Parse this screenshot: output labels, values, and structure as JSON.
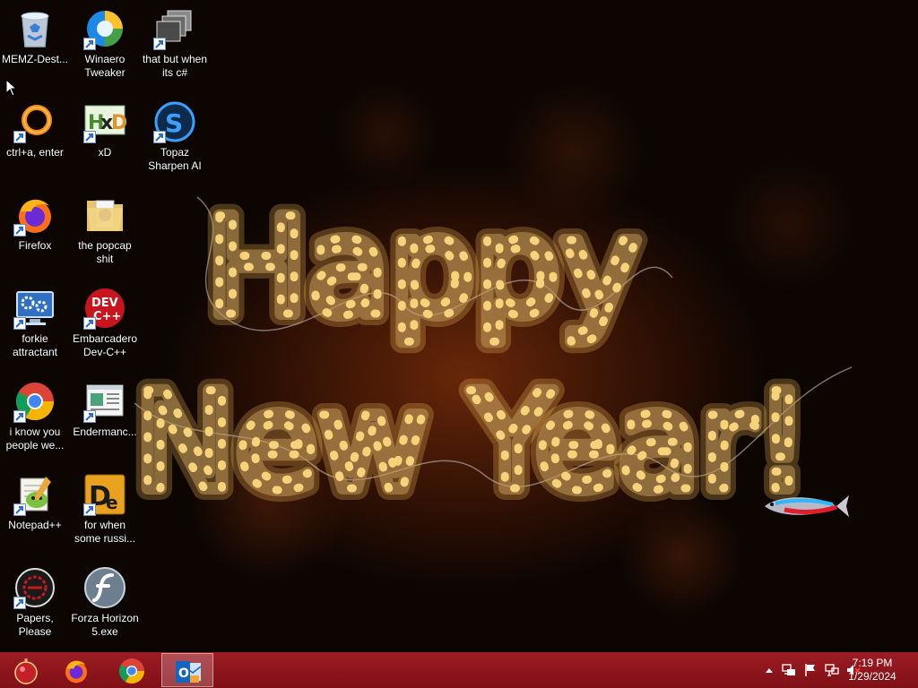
{
  "desktop": {
    "icons": [
      {
        "label": "MEMZ-Dest...",
        "icon": "recycle-bin-icon",
        "shortcut": false
      },
      {
        "label": "Winaero Tweaker",
        "icon": "winaero-swirl-icon",
        "shortcut": true
      },
      {
        "label": "that but when its c#",
        "icon": "stacked-windows-icon",
        "shortcut": true
      },
      {
        "label": "ctrl+a, enter",
        "icon": "orange-ring-icon",
        "shortcut": true
      },
      {
        "label": "xD",
        "icon": "hxd-hex-editor-icon",
        "shortcut": true
      },
      {
        "label": "Topaz Sharpen AI",
        "icon": "topaz-s-icon",
        "shortcut": true
      },
      {
        "label": "Firefox",
        "icon": "firefox-icon",
        "shortcut": true
      },
      {
        "label": "the popcap shit",
        "icon": "folder-icon",
        "shortcut": false
      },
      {
        "label": "forkie attractant",
        "icon": "settings-monitor-icon",
        "shortcut": true
      },
      {
        "label": "Embarcadero Dev-C++",
        "icon": "dev-cpp-icon",
        "shortcut": true
      },
      {
        "label": "i know you people we...",
        "icon": "chrome-icon",
        "shortcut": true
      },
      {
        "label": "Endermanc...",
        "icon": "window-document-icon",
        "shortcut": true
      },
      {
        "label": "Notepad++",
        "icon": "notepad-plus-plus-icon",
        "shortcut": true
      },
      {
        "label": "for when some russi...",
        "icon": "de-icon",
        "shortcut": true
      },
      {
        "label": "Papers, Please",
        "icon": "papers-please-seal-icon",
        "shortcut": true
      },
      {
        "label": "Forza Horizon 5.exe",
        "icon": "flash-player-icon",
        "shortcut": false
      }
    ],
    "wallpaper": {
      "line1": "Happy",
      "line2": "New Year!"
    }
  },
  "taskbar": {
    "buttons": [
      {
        "name": "start-button",
        "icon": "start-orb-icon"
      },
      {
        "name": "firefox",
        "icon": "firefox-icon"
      },
      {
        "name": "chrome",
        "icon": "chrome-icon"
      },
      {
        "name": "outlook",
        "icon": "outlook-icon",
        "active": true
      }
    ],
    "tray": {
      "time": "7:19 PM",
      "date": "1/29/2024",
      "icons": [
        "show-hidden-icons-arrow",
        "devices-icon",
        "action-center-flag-icon",
        "network-icon",
        "volume-muted-icon"
      ]
    }
  },
  "colors": {
    "taskbar": "#8a141b",
    "wallpaper_glow": "#f6d27a",
    "shortcut_arrow": "#2a6ad6"
  }
}
